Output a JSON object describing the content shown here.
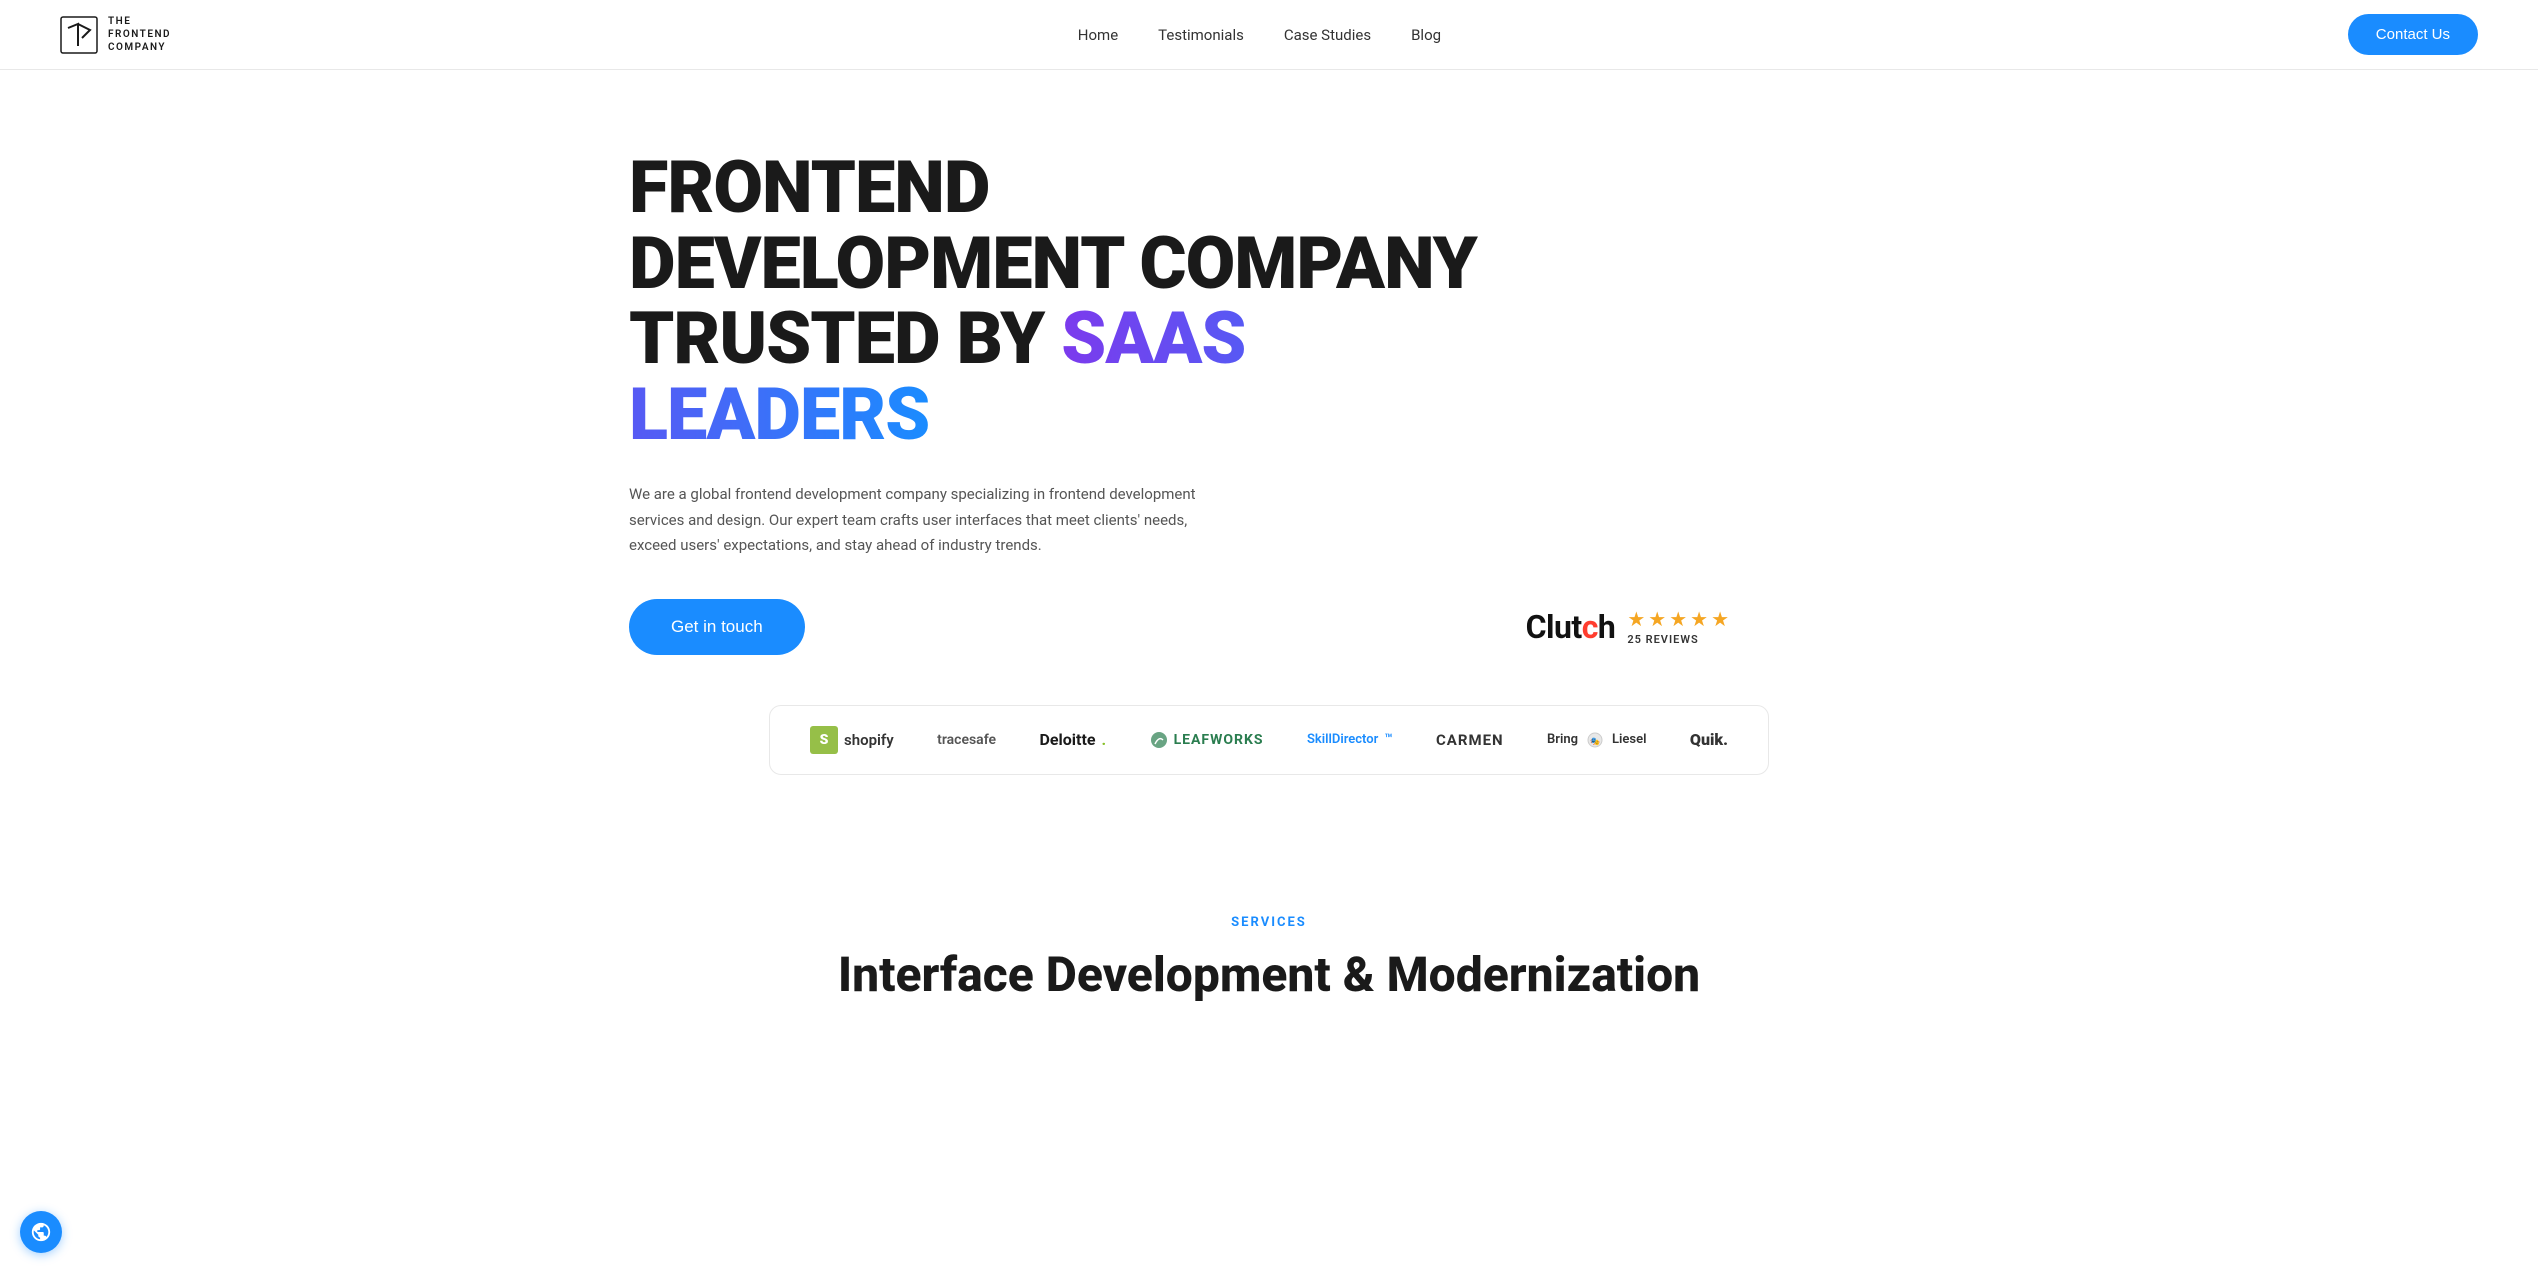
{
  "navbar": {
    "logo": {
      "line1": "THE",
      "line2": "FRONTEND",
      "line3": "COMPANY"
    },
    "links": [
      {
        "label": "Home",
        "id": "home"
      },
      {
        "label": "Testimonials",
        "id": "testimonials"
      },
      {
        "label": "Case Studies",
        "id": "case-studies"
      },
      {
        "label": "Blog",
        "id": "blog"
      }
    ],
    "contact_btn": "Contact Us"
  },
  "hero": {
    "title_line1": "FRONTEND",
    "title_line2": "DEVELOPMENT COMPANY",
    "title_line3": "TRUSTED BY",
    "title_gradient": "SAAS LEADERS",
    "description": "We are a global frontend development company specializing in frontend development services and design. Our expert team crafts user interfaces that meet clients' needs, exceed users' expectations, and stay ahead of industry trends.",
    "cta_btn": "Get in touch",
    "clutch_logo": "Clutch",
    "clutch_reviews": "25 REVIEWS"
  },
  "logos": [
    {
      "id": "shopify",
      "label": "shopify"
    },
    {
      "id": "tracesafe",
      "label": "tracesafe"
    },
    {
      "id": "deloitte",
      "label": "Deloitte."
    },
    {
      "id": "leafworks",
      "label": "LEAFWORKS"
    },
    {
      "id": "skilldirector",
      "label": "SkillDirector"
    },
    {
      "id": "carmen",
      "label": "CARMEN"
    },
    {
      "id": "bringliesel",
      "label": "BringLiesel"
    },
    {
      "id": "quik",
      "label": "Quik."
    }
  ],
  "services": {
    "section_label": "SERVICES",
    "section_title": "Interface Development & Modernization"
  }
}
